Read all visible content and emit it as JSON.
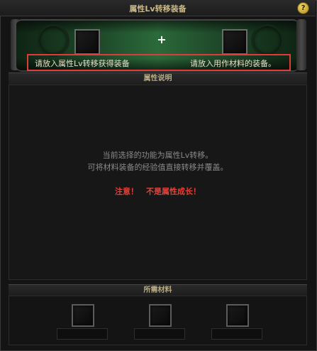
{
  "window": {
    "title": "属性Lv转移装备",
    "help_label": "?"
  },
  "transfer": {
    "plus_symbol": "+",
    "source_hint": "请放入属性Lv转移获得装备",
    "target_hint": "请放入用作材料的装备。"
  },
  "description": {
    "header": "属性说明",
    "line1": "当前选择的功能为属性Lv转移。",
    "line2": "可将材料装备的经验值直接转移并覆盖。",
    "warning": "注意！　不是属性成长！"
  },
  "materials": {
    "header": "所需材料",
    "slot_count": 3
  },
  "colors": {
    "highlight_border": "#e03a3a",
    "warning_text": "#e0423a",
    "title_text": "#c9b98a",
    "scroll_green": "#2b6a3a"
  }
}
